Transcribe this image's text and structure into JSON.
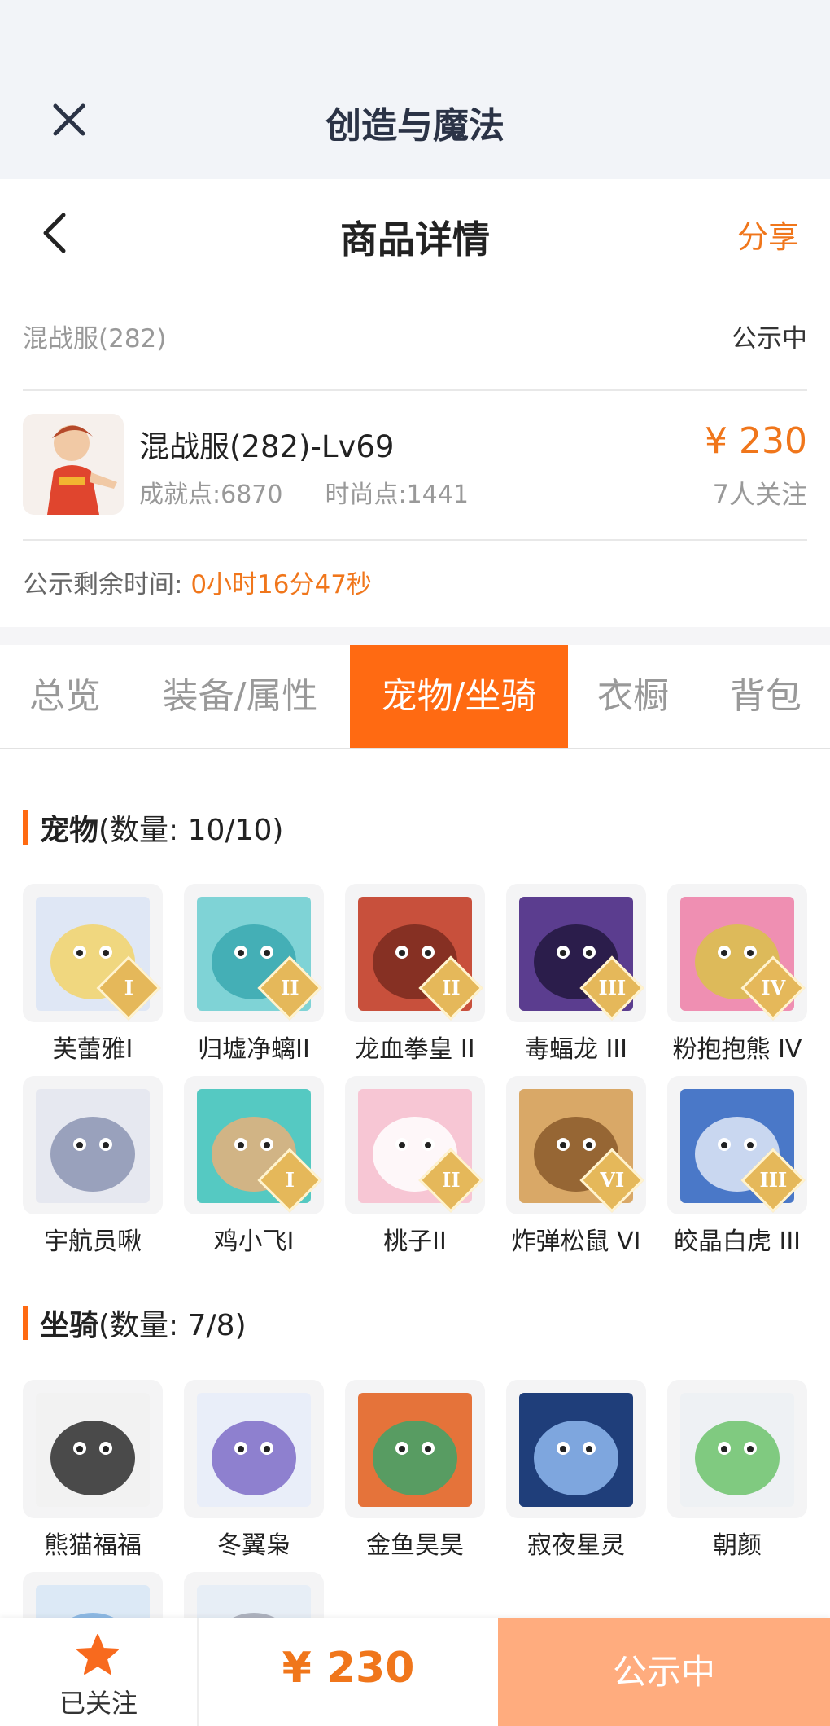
{
  "app": {
    "title": "创造与魔法"
  },
  "nav": {
    "title": "商品详情",
    "share": "分享"
  },
  "listing": {
    "server": "混战服(282)",
    "status": "公示中",
    "name": "混战服(282)-Lv69",
    "achievement": "成就点:6870",
    "fashion": "时尚点:1441",
    "price": "¥ 230",
    "followers": "7人关注",
    "countdown_label": "公示剩余时间:",
    "countdown_value": "0小时16分47秒"
  },
  "tabs": [
    "总览",
    "装备/属性",
    "宠物/坐骑",
    "衣橱",
    "背包"
  ],
  "active_tab": "宠物/坐骑",
  "pets": {
    "title": "宠物",
    "count": "(数量: 10/10)",
    "items": [
      {
        "name": "芙蕾雅I",
        "badge": "I",
        "colors": [
          "#dfe7f5",
          "#f3d46a"
        ]
      },
      {
        "name": "归墟净螭II",
        "badge": "II",
        "colors": [
          "#7fd3d6",
          "#3aa8b0"
        ]
      },
      {
        "name": "龙血拳皇 II",
        "badge": "II",
        "colors": [
          "#c8503c",
          "#7a2a1e"
        ]
      },
      {
        "name": "毒蝠龙 III",
        "badge": "III",
        "colors": [
          "#5b3d8f",
          "#23183f"
        ]
      },
      {
        "name": "粉抱抱熊 IV",
        "badge": "IV",
        "colors": [
          "#ef8fb2",
          "#d9c24a"
        ]
      },
      {
        "name": "宇航员啾",
        "badge": "",
        "colors": [
          "#e6e8f0",
          "#8b94b3"
        ]
      },
      {
        "name": "鸡小飞I",
        "badge": "I",
        "colors": [
          "#55c9c2",
          "#e8b07a"
        ]
      },
      {
        "name": "桃子II",
        "badge": "II",
        "colors": [
          "#f7c6d4",
          "#ffffff"
        ]
      },
      {
        "name": "炸弹松鼠 VI",
        "badge": "VI",
        "colors": [
          "#d9a867",
          "#8a5a2b"
        ]
      },
      {
        "name": "皎晶白虎 III",
        "badge": "III",
        "colors": [
          "#4a78c8",
          "#dfe8f7"
        ]
      }
    ]
  },
  "mounts": {
    "title": "坐骑",
    "count": "(数量: 7/8)",
    "items": [
      {
        "name": "熊猫福福",
        "colors": [
          "#f2f2f2",
          "#2d2d2d"
        ]
      },
      {
        "name": "冬翼枭",
        "colors": [
          "#e9eef9",
          "#7e6cc8"
        ]
      },
      {
        "name": "金鱼昊昊",
        "colors": [
          "#e5733a",
          "#3fa36a"
        ]
      },
      {
        "name": "寂夜星灵",
        "colors": [
          "#1f3e7a",
          "#8fb8f0"
        ]
      },
      {
        "name": "朝颜",
        "colors": [
          "#eef1f4",
          "#6cc36b"
        ]
      },
      {
        "name": "",
        "colors": [
          "#dce9f6",
          "#7fb0e0"
        ]
      },
      {
        "name": "",
        "colors": [
          "#e7eef6",
          "#a3a8b5"
        ]
      }
    ]
  },
  "bottom": {
    "follow_label": "已关注",
    "price": "¥ 230",
    "action": "公示中"
  },
  "theme": {
    "accent": "#ff6a12",
    "price": "#f0761b",
    "action_bg": "#ffac7e"
  }
}
